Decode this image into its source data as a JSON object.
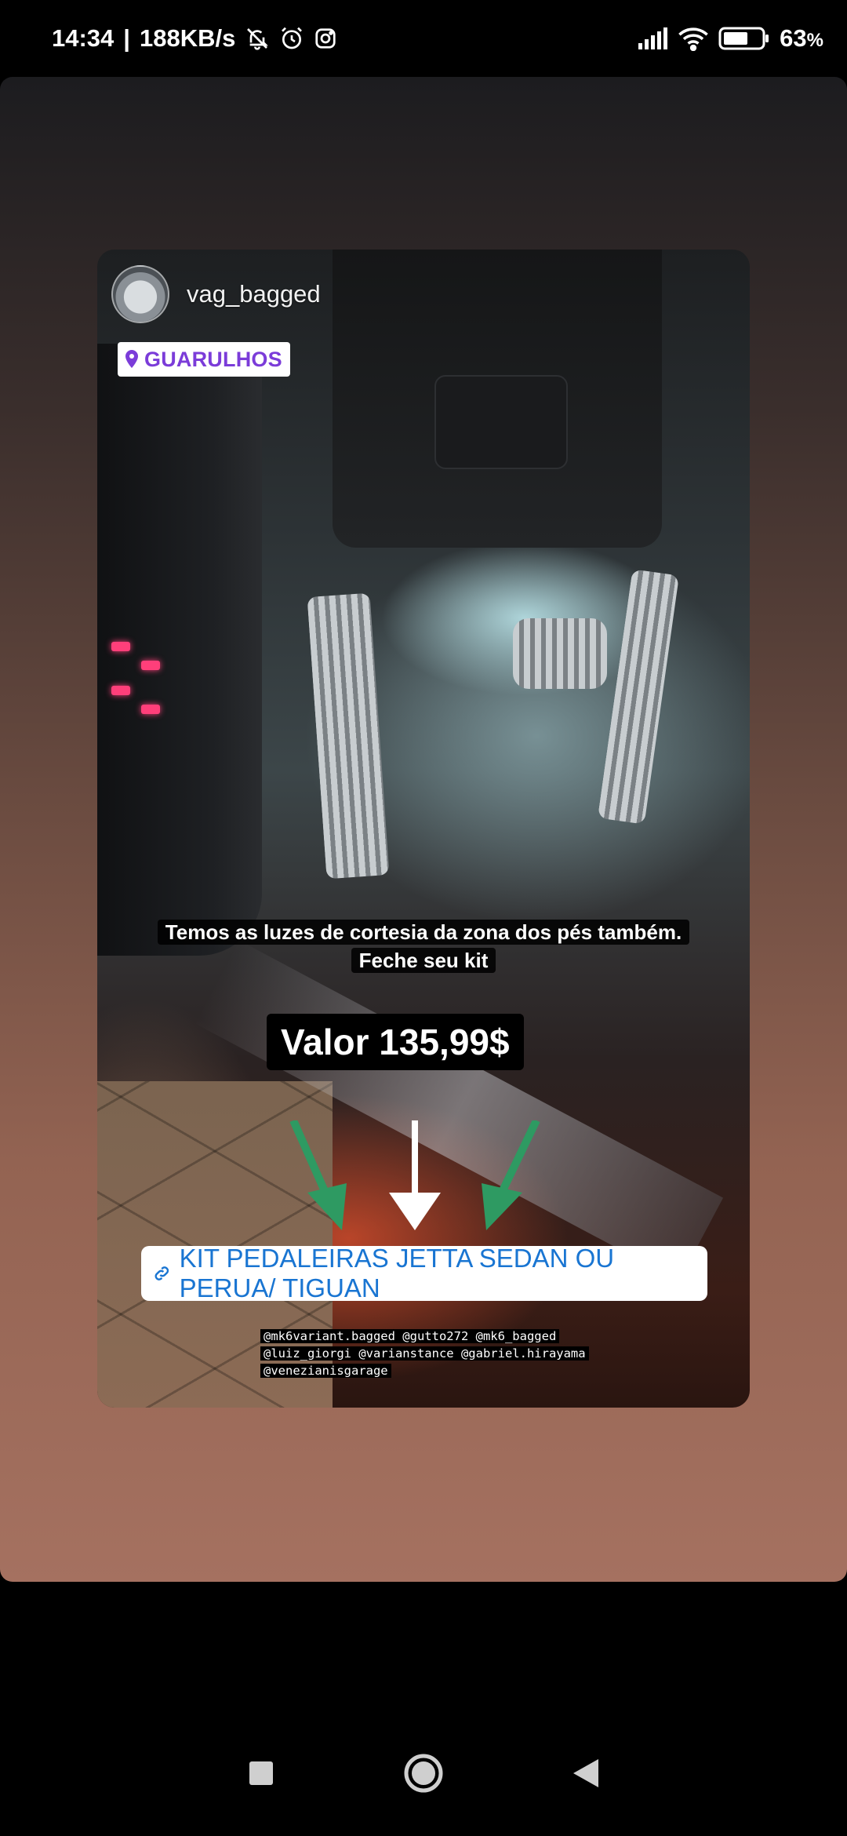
{
  "status_bar": {
    "time": "14:34",
    "network_speed": "188KB/s",
    "battery_percent": "63",
    "battery_suffix": "%",
    "icons": [
      "bell-muted-icon",
      "alarm-icon",
      "instagram-icon",
      "signal-icon",
      "wifi-icon",
      "battery-icon"
    ]
  },
  "story": {
    "username": "vag_bagged",
    "location": "GUARULHOS",
    "caption_line1": "Temos as luzes de cortesia da zona dos pés também.",
    "caption_line2": "Feche seu kit",
    "price": "Valor 135,99$",
    "link_label": "KIT PEDALEIRAS JETTA SEDAN OU PERUA/ TIGUAN",
    "credits": [
      "@mk6variant.bagged @gutto272 @mk6_bagged",
      "@luiz_giorgi @varianstance @gabriel.hirayama",
      "@venezianisgarage"
    ],
    "arrow_colors": [
      "#2e9a62",
      "#ffffff",
      "#2e9a62"
    ]
  },
  "nav_bar": {
    "buttons": [
      "recents-button",
      "home-button",
      "back-button"
    ]
  },
  "colors": {
    "location_text": "#7b3cd9",
    "link_text": "#1975d2"
  }
}
